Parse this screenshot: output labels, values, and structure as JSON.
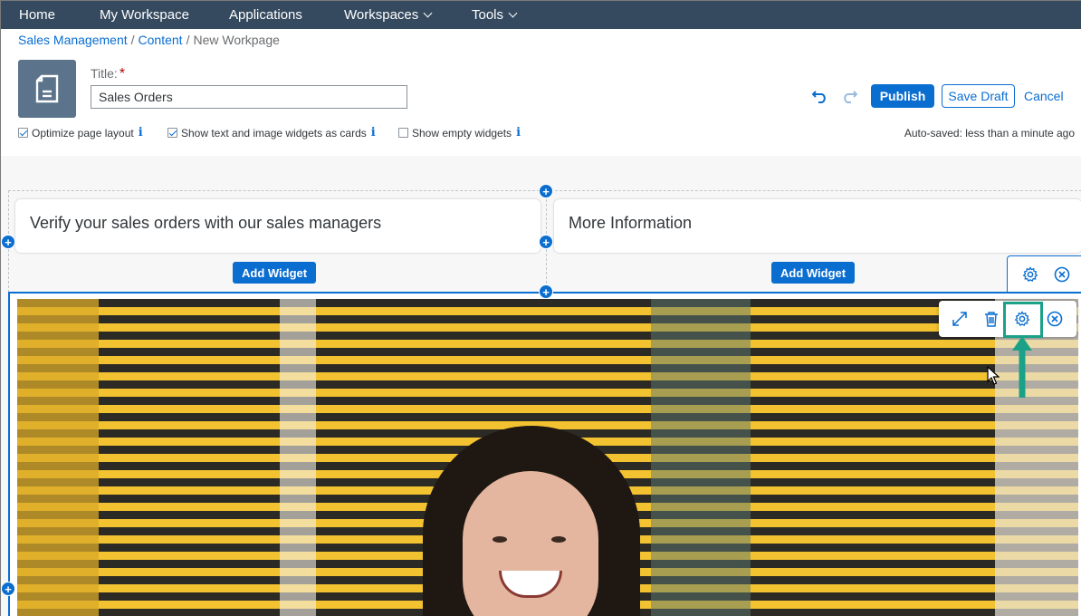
{
  "nav": {
    "home": "Home",
    "my_workspace": "My Workspace",
    "applications": "Applications",
    "workspaces": "Workspaces",
    "tools": "Tools"
  },
  "breadcrumb": {
    "item1": "Sales Management",
    "item2": "Content",
    "current": "New Workpage",
    "sep": "/"
  },
  "title": {
    "label": "Title:",
    "required_mark": "*",
    "value": "Sales Orders"
  },
  "actions": {
    "publish": "Publish",
    "save_draft": "Save Draft",
    "cancel": "Cancel"
  },
  "options": {
    "optimize": {
      "label": "Optimize page layout",
      "checked": true
    },
    "cards": {
      "label": "Show text and image widgets as cards",
      "checked": true
    },
    "empty": {
      "label": "Show empty widgets",
      "checked": false
    },
    "info_glyph": "i"
  },
  "autosave": "Auto-saved: less than a minute ago",
  "widgets": {
    "card1": "Verify your sales orders with our sales managers",
    "card2": "More Information",
    "add_widget": "Add Widget"
  },
  "icons": {
    "page": "document-icon",
    "undo": "undo-icon",
    "redo": "redo-icon",
    "expand": "expand-icon",
    "delete": "trash-icon",
    "settings": "gear-icon",
    "close": "close-circle-icon",
    "add": "plus-circle-icon"
  },
  "colors": {
    "shell": "#354a5f",
    "accent": "#0a6ed1",
    "highlight": "#1aa187"
  }
}
